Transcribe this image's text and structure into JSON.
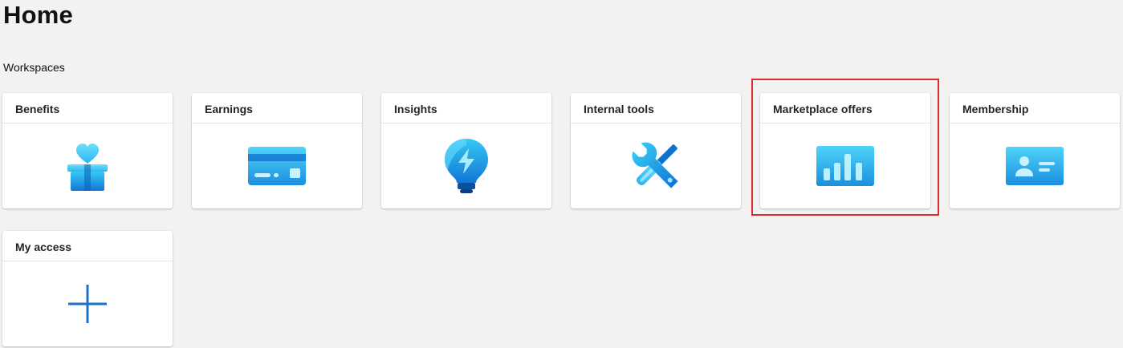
{
  "page": {
    "title": "Home",
    "section_label": "Workspaces"
  },
  "tiles": [
    {
      "label": "Benefits",
      "icon": "gift-heart-icon"
    },
    {
      "label": "Earnings",
      "icon": "credit-card-icon"
    },
    {
      "label": "Insights",
      "icon": "lightbulb-icon"
    },
    {
      "label": "Internal tools",
      "icon": "wrench-screwdriver-icon"
    },
    {
      "label": "Marketplace offers",
      "icon": "bar-chart-icon",
      "highlighted": true
    },
    {
      "label": "Membership",
      "icon": "id-card-icon"
    },
    {
      "label": "My access",
      "icon": "plus-icon"
    }
  ],
  "colors": {
    "background": "#f2f2f2",
    "tile": "#ffffff",
    "accent": "#1a9ee8",
    "highlight": "#e02a2a",
    "plus": "#1a73c8"
  }
}
